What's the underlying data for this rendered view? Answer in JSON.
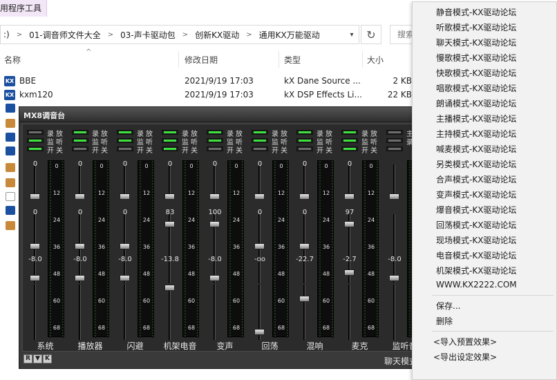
{
  "explorer": {
    "ribbon_tab": "用程序工具",
    "breadcrumb": [
      ":)",
      "01-调音师文件大全",
      "03-声卡驱动包",
      "创新KX驱动",
      "通用KX万能驱动"
    ],
    "search_placeholder": "搜索",
    "columns": {
      "name": "名称",
      "modified": "修改日期",
      "type": "类型",
      "size": "大小"
    },
    "files": [
      {
        "name": "BBE",
        "modified": "2021/9/19 17:03",
        "type": "kX Dane Source ...",
        "size": "2 KB"
      },
      {
        "name": "kxm120",
        "modified": "2021/9/19 17:03",
        "type": "kX DSP Effects Li...",
        "size": "22 KB"
      }
    ]
  },
  "mixer": {
    "title": "MX8调音台",
    "led_labels": [
      "录放",
      "监听",
      "开关"
    ],
    "channels": [
      {
        "name": "系统",
        "top": "0",
        "mid": "0",
        "bottom": "-8.0",
        "leds": [
          "off",
          "on",
          "on"
        ]
      },
      {
        "name": "播放器",
        "top": "0",
        "mid": "0",
        "bottom": "-8.0",
        "leds": [
          "on",
          "on",
          "off"
        ]
      },
      {
        "name": "闪避",
        "top": "0",
        "mid": "0",
        "bottom": "-8.0",
        "leds": [
          "on",
          "on",
          "off"
        ]
      },
      {
        "name": "机架电音",
        "top": "0",
        "mid": "83",
        "bottom": "-13.8",
        "leds": [
          "on",
          "on",
          "on"
        ]
      },
      {
        "name": "变声",
        "top": "0",
        "mid": "100",
        "bottom": "-8.0",
        "leds": [
          "on",
          "on",
          "off"
        ]
      },
      {
        "name": "回荡",
        "top": "0",
        "mid": "0",
        "bottom": "-oo",
        "leds": [
          "on",
          "on",
          "off"
        ]
      },
      {
        "name": "混响",
        "top": "0",
        "mid": "0",
        "bottom": "-22.7",
        "leds": [
          "on",
          "on",
          "off"
        ]
      },
      {
        "name": "麦克",
        "top": "0",
        "mid": "97",
        "bottom": "-2.7",
        "leds": [
          "on",
          "on",
          "on"
        ]
      },
      {
        "name": "监听音",
        "top": "",
        "mid": "",
        "bottom": "-8.0",
        "leds": [
          "off",
          "off",
          "off"
        ]
      }
    ],
    "meter_ticks": [
      "0",
      "12",
      "24",
      "36",
      "48",
      "60",
      "68"
    ],
    "partial_labels": [
      "主",
      "录"
    ],
    "footer_buttons": [
      "R",
      "▼",
      "K"
    ],
    "footer_right": "聊天模式"
  },
  "context_menu": {
    "items": [
      "静音模式-KX驱动论坛",
      "听歌模式-KX驱动论坛",
      "聊天模式-KX驱动论坛",
      "慢歌模式-KX驱动论坛",
      "快歌模式-KX驱动论坛",
      "唱歌模式-KX驱动论坛",
      "朗诵模式-KX驱动论坛",
      "主播模式-KX驱动论坛",
      "主持模式-KX驱动论坛",
      "喊麦模式-KX驱动论坛",
      "另类模式-KX驱动论坛",
      "合声模式-KX驱动论坛",
      "变声模式-KX驱动论坛",
      "爆音模式-KX驱动论坛",
      "回荡模式-KX驱动论坛",
      "现场模式-KX驱动论坛",
      "电音模式-KX驱动论坛",
      "机架模式-KX驱动论坛",
      "WWW.KX2222.COM"
    ],
    "save": "保存...",
    "delete": "删除",
    "import": "<导入预置效果>",
    "export": "<导出设定效果>"
  }
}
